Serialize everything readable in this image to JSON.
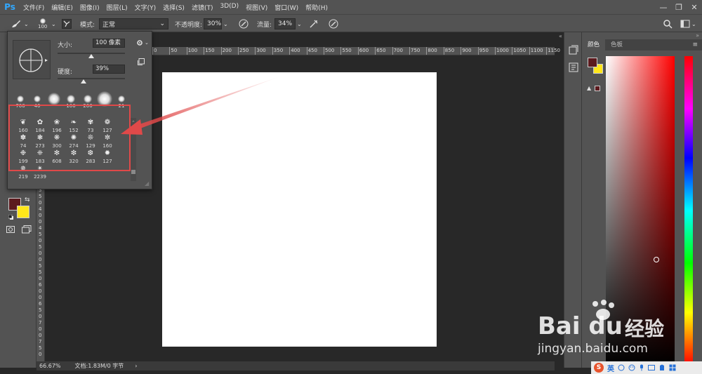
{
  "app": {
    "logo": "Ps"
  },
  "menu": [
    {
      "label": "文件(F)"
    },
    {
      "label": "编辑(E)"
    },
    {
      "label": "图像(I)"
    },
    {
      "label": "图层(L)"
    },
    {
      "label": "文字(Y)"
    },
    {
      "label": "选择(S)"
    },
    {
      "label": "滤镜(T)"
    },
    {
      "label": "3D(D)"
    },
    {
      "label": "视图(V)"
    },
    {
      "label": "窗口(W)"
    },
    {
      "label": "帮助(H)"
    }
  ],
  "window_controls": {
    "minimize": "—",
    "restore": "❐",
    "close": "✕"
  },
  "options": {
    "brush_size": "100",
    "mode_label": "模式:",
    "mode_value": "正常",
    "opacity_label": "不透明度:",
    "opacity_value": "30%",
    "flow_label": "流量:",
    "flow_value": "34%"
  },
  "brush_panel": {
    "size_label": "大小:",
    "size_value": "100 像素",
    "hardness_label": "硬度:",
    "hardness_value": "39%",
    "size_fraction": 0.5,
    "hardness_fraction": 0.39,
    "tips": [
      {
        "num": "700",
        "size": 10
      },
      {
        "num": "40",
        "size": 10
      },
      {
        "num": "",
        "size": 18
      },
      {
        "num": "100",
        "size": 12
      },
      {
        "num": "200",
        "size": 12
      },
      {
        "num": "",
        "size": 22
      },
      {
        "num": "21",
        "size": 10
      }
    ],
    "presets": [
      {
        "num": "160"
      },
      {
        "num": "184"
      },
      {
        "num": "196"
      },
      {
        "num": "152"
      },
      {
        "num": "73"
      },
      {
        "num": "127"
      },
      {
        "num": "74"
      },
      {
        "num": "273"
      },
      {
        "num": "300"
      },
      {
        "num": "274"
      },
      {
        "num": "129"
      },
      {
        "num": "160"
      },
      {
        "num": "199"
      },
      {
        "num": "183"
      },
      {
        "num": "608"
      },
      {
        "num": "320"
      },
      {
        "num": "283"
      },
      {
        "num": "127"
      },
      {
        "num": "219"
      },
      {
        "num": "2239"
      }
    ]
  },
  "rulers": {
    "top": [
      "0",
      "50",
      "100",
      "150",
      "200",
      "250",
      "300",
      "350",
      "400",
      "450",
      "500",
      "550",
      "600",
      "650",
      "700",
      "750",
      "800",
      "850",
      "900",
      "950",
      "1000",
      "1050",
      "1100",
      "1150"
    ],
    "left_digits": [
      "3",
      "5",
      "0",
      "4",
      "0",
      "0",
      "4",
      "5",
      "0",
      "5",
      "0",
      "0",
      "5",
      "5",
      "0",
      "6",
      "0",
      "0",
      "6",
      "5",
      "0",
      "7",
      "0",
      "0",
      "7",
      "5",
      "0"
    ]
  },
  "status": {
    "zoom": "66.67%",
    "doc": "文档:1.83M/0 字节",
    "arrow": "›"
  },
  "color_panel": {
    "tab_color": "颜色",
    "tab_swatches": "色板",
    "foreground": "#5c1a1e",
    "background": "#ffe61a",
    "warning": "▲"
  },
  "toolbar_colors": {
    "foreground": "#5c1a1e",
    "background": "#ffe61a"
  },
  "tray": {
    "ime": "英"
  },
  "watermark": {
    "brand": "Bai  du",
    "suffix": "经验",
    "url": "jingyan.baidu.com"
  },
  "annotation": {
    "box_color": "#e04949",
    "arrow_color": "#e04949"
  }
}
